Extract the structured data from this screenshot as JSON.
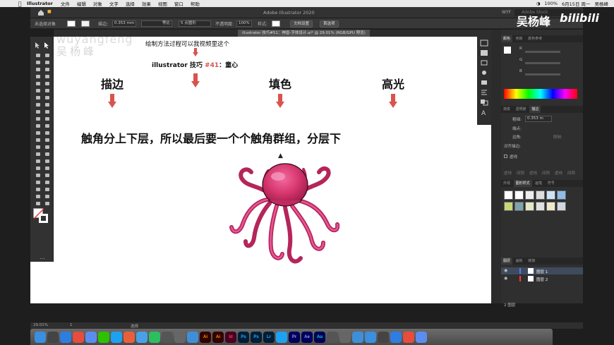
{
  "menubar": {
    "app_name": "Illustrator",
    "items": [
      "文件",
      "编辑",
      "对象",
      "文字",
      "选择",
      "效果",
      "视图",
      "窗口",
      "帮助"
    ],
    "battery": "100%",
    "clock": "6月15日 周一",
    "user": "吴杨峰"
  },
  "appbar": {
    "title": "Adobe Illustrator 2020",
    "workspace": "WYF",
    "search_placeholder": "Adobe Stock"
  },
  "controlbar": {
    "selection_state": "未选择对象",
    "stroke_label": "描边:",
    "stroke_value": "0.353 mm",
    "stroke_style": "等比",
    "brush": "5 点圆形",
    "opacity_label": "不透明度:",
    "opacity_value": "100%",
    "style_label": "样式:",
    "doc_setup": "文档设置",
    "prefs": "首选项"
  },
  "document_tab": "illustrator 技巧#51：神兽-字体设计.ai* @ 29.01% (RGB/GPU 预览)",
  "canvas": {
    "watermark_en": "wuyangfeng",
    "watermark_cn": "吴杨峰",
    "note": "绘制方法过程可以我视频里这个",
    "tip_prefix": "illustrator 技巧 ",
    "tip_number": "#41",
    "tip_suffix": "：童心",
    "col_stroke": "描边",
    "col_fill": "填色",
    "col_highlight": "高光",
    "headline": "触角分上下层，所以最后要一个个触角群组，分层下"
  },
  "panels": {
    "top_tabs": [
      "颜色",
      "色板",
      "颜色参考"
    ],
    "rgb": [
      "R",
      "G",
      "B"
    ],
    "stroke_tabs": [
      "渐变",
      "透明度",
      "描边"
    ],
    "stroke_weight_label": "粗细:",
    "stroke_weight_value": "0.353 m",
    "cap_label": "端点:",
    "corner_label": "边角:",
    "limit_label": "限制:",
    "align_label": "对齐描边:",
    "dash_label": "虚线",
    "dash_cells": [
      "虚线",
      "间隙",
      "虚线",
      "间隙",
      "虚线",
      "间隙"
    ],
    "styles_tabs": [
      "外观",
      "图形样式",
      "画笔",
      "符号"
    ],
    "layers_tabs": [
      "图层",
      "画板",
      "链接"
    ],
    "layers": [
      {
        "name": "图层 1",
        "color": "#4f7bff"
      },
      {
        "name": "图层 2",
        "color": "#ff3b3b"
      }
    ],
    "layer_count": "2 图层"
  },
  "brand": {
    "name": "吴杨峰",
    "site": "bilibili"
  },
  "statusbar": {
    "zoom": "29.01%",
    "page": "1",
    "mode": "选择"
  },
  "colors": {
    "accent_arrow": "#d9534f",
    "octopus": "#d6366d",
    "canvas_bg": "#ffffff",
    "app_bg": "#323232"
  },
  "dock": [
    "Finder",
    "Launchpad",
    "Safari",
    "Chrome",
    "Mail",
    "WeChat",
    "QQ",
    "Paw",
    "Folder",
    "Evernote",
    "Meta",
    "Scissors",
    "Wave",
    "Ai",
    "Ai",
    "Id",
    "Ps",
    "Ps",
    "Lr",
    "Sketch",
    "Pr",
    "Ae",
    "Au",
    "Cc",
    "Ga",
    "Ghost",
    "Settings",
    "MindNode",
    "Maps",
    "Terminal",
    "Trash"
  ]
}
